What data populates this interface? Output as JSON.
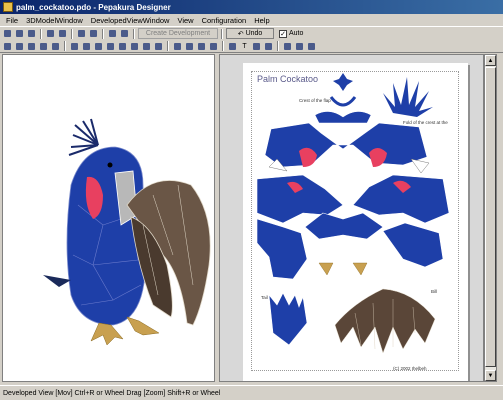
{
  "window": {
    "title": "palm_cockatoo.pdo - Pepakura Designer"
  },
  "menu": [
    "File",
    "3DModelWindow",
    "DevelopedViewWindow",
    "View",
    "Configuration",
    "Help"
  ],
  "toolbar": {
    "create_development_label": "Create Development",
    "undo_label": "Undo",
    "auto_label": "Auto",
    "auto_checked": "✓"
  },
  "paper": {
    "title": "Palm Cockatoo",
    "labels": {
      "crest": "Crest of the flap",
      "body_fold": "Fold of the crest at the",
      "tail": "Tail",
      "bill": "Bill",
      "copyright": "(C) 2002 Ihelbeh"
    }
  },
  "colors": {
    "body_blue": "#1e3fa8",
    "cheek_red": "#e84060",
    "bill_brown": "#5a4638",
    "foot_tan": "#c8a050"
  },
  "status": {
    "text": "Developed View [Mov] Ctrl+R or Wheel Drag [Zoom] Shift+R or Wheel"
  }
}
